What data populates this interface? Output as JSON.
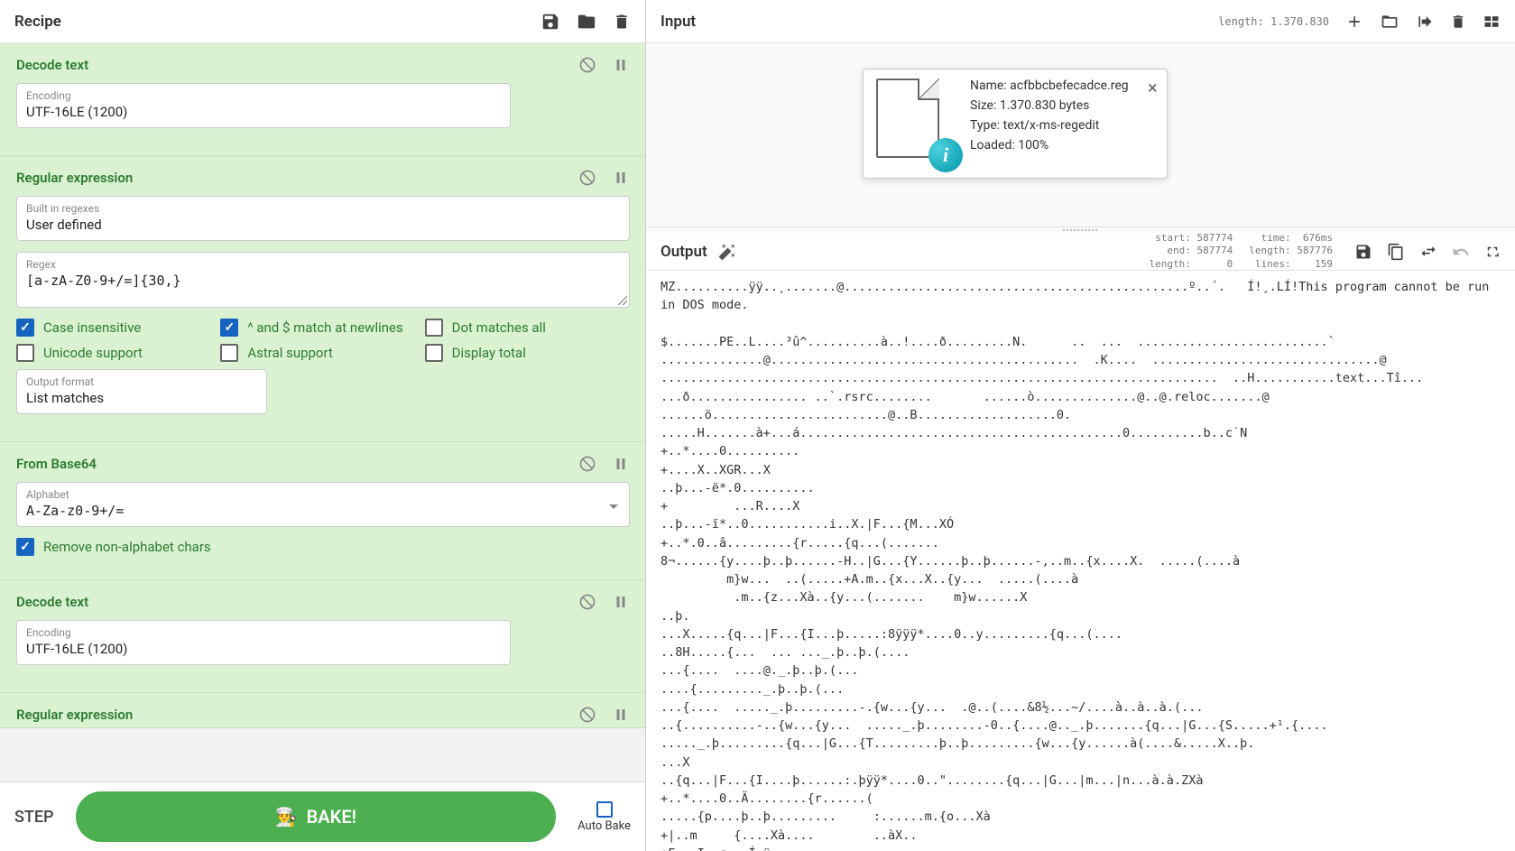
{
  "recipe": {
    "title": "Recipe",
    "footer": {
      "step": "STEP",
      "bake": "BAKE!",
      "autobake": "Auto Bake"
    },
    "ops": [
      {
        "name": "Decode text",
        "fields": {
          "encoding_label": "Encoding",
          "encoding_value": "UTF-16LE (1200)"
        }
      },
      {
        "name": "Regular expression",
        "fields": {
          "builtin_label": "Built in regexes",
          "builtin_value": "User defined",
          "regex_label": "Regex",
          "regex_value": "[a-zA-Z0-9+/=]{30,}",
          "output_label": "Output format",
          "output_value": "List matches"
        },
        "checks": {
          "ci": "Case insensitive",
          "newlines": "^ and $ match at newlines",
          "dot": "Dot matches all",
          "unicode": "Unicode support",
          "astral": "Astral support",
          "display": "Display total"
        }
      },
      {
        "name": "From Base64",
        "fields": {
          "alpha_label": "Alphabet",
          "alpha_value": "A-Za-z0-9+/="
        },
        "checks": {
          "remove": "Remove non-alphabet chars"
        }
      },
      {
        "name": "Decode text",
        "fields": {
          "encoding_label": "Encoding",
          "encoding_value": "UTF-16LE (1200)"
        }
      },
      {
        "name": "Regular expression"
      }
    ]
  },
  "input": {
    "title": "Input",
    "length_label": "length: 1.370.830",
    "popup": {
      "name": "Name: acfbbcbefecadce.reg",
      "size": "Size: 1.370.830 bytes",
      "type": "Type: text/x-ms-regedit",
      "loaded": "Loaded: 100%"
    }
  },
  "output": {
    "title": "Output",
    "stats_l": "start: 587774\n  end: 587774\nlength:      0",
    "stats_r": "  time:  676ms\nlength: 587776\n lines:    159",
    "text": "MZ..........ÿÿ..¸.......@...............................................º..´.\tÍ!¸.LÍ!This program cannot be run in DOS mode.\n\n$.......PE..L....³û^..........à..!....ð.........N.      ..  ...  ..........................`\n..............@..........................................  .K....  ...............................@\n............................................................................  ..H...........text...Tî...\n...ð................ ..`.rsrc........       ......ò..............@..@.reloc.......@\n......ö........................@..B...................0.\n.....H.......à+...á............................................0..........b..c˙N\n+..*....0..........\n+....X..XGR...X\n..þ...-ë*.0..........\n+         ...R....X\n..þ...-ï*..0...........i..X.|F...{M...XÓ\n+..*.0..â.........{r.....{q...(.......\n8¬......{y....þ..þ......-H..|G...{Y......þ..þ......-,..m..{x....X.  .....(....à\n         m}w...  ..(.....+A.m..{x...X..{y...  .....(....à\n          .m..{z...Xà..{y...(.......    m}w......X\n..þ.\n...X.....{q...|F...{I...þ.....:8ÿÿÿ*....0..y.........{q...(....\n..8H.....{...  ... ..._.þ..þ.(....\n...{....  ....@._.þ..þ.(...\n....{........._.þ..þ.(...\n...{....  ....._.þ.........-.{w...{y...  .@..(....&8½...~/....à..à..à.(...\n..{..........-..{w...{y...  ....._.þ........-0..{....@.._.þ.......{q...|G...{S.....+¹.{....\n....._.þ.........{q...|G...{T.........þ..þ.........{w...{y......à(....&.....X..þ.\n...X\n..{q...|F...{I....þ......:.þÿÿ*....0..\"........{q...|G...|m...|n...à.à.ZXà\n+..*....0..Ä........{r......(\n.....{p....þ..þ.........     :......m.{o...Xà\n+|..m     {....Xà....        ..àX..\n+F...I..c...Í ÿ..........."
  }
}
